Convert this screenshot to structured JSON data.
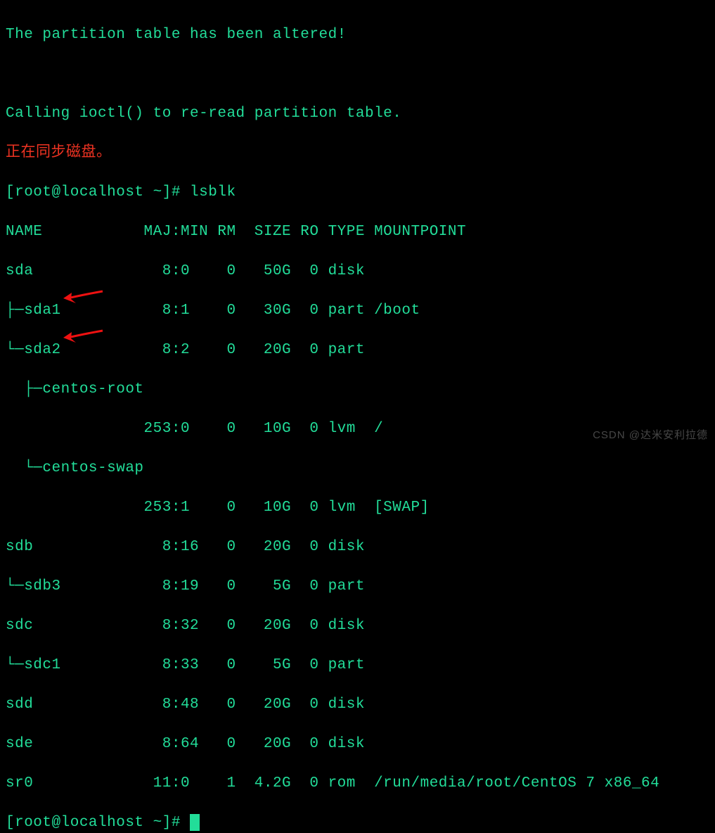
{
  "lines": {
    "msg1": "The partition table has been altered!",
    "blank": "",
    "msg2": "Calling ioctl() to re-read partition table.",
    "msg3": "正在同步磁盘。",
    "prompt1": "[root@localhost ~]# lsblk",
    "hdr": "NAME           MAJ:MIN RM  SIZE RO TYPE MOUNTPOINT",
    "sda": "sda              8:0    0   50G  0 disk ",
    "sda1": "├─sda1           8:1    0   30G  0 part /boot",
    "sda2": "└─sda2           8:2    0   20G  0 part ",
    "croot_lbl": "  ├─centos-root",
    "croot_val": "               253:0    0   10G  0 lvm  /",
    "cswap_lbl": "  └─centos-swap",
    "cswap_val": "               253:1    0   10G  0 lvm  [SWAP]",
    "sdb": "sdb              8:16   0   20G  0 disk ",
    "sdb3": "└─sdb3           8:19   0    5G  0 part ",
    "sdc": "sdc              8:32   0   20G  0 disk ",
    "sdc1": "└─sdc1           8:33   0    5G  0 part ",
    "sdd": "sdd              8:48   0   20G  0 disk ",
    "sde": "sde              8:64   0   20G  0 disk ",
    "sr0": "sr0             11:0    1  4.2G  0 rom  /run/media/root/CentOS 7 x86_64",
    "prompt2": "[root@localhost ~]# "
  },
  "watermark": "CSDN @达米安利拉德",
  "chart_data": {
    "type": "table",
    "title": "lsblk output",
    "columns": [
      "NAME",
      "MAJ:MIN",
      "RM",
      "SIZE",
      "RO",
      "TYPE",
      "MOUNTPOINT"
    ],
    "rows": [
      {
        "NAME": "sda",
        "MAJ:MIN": "8:0",
        "RM": 0,
        "SIZE": "50G",
        "RO": 0,
        "TYPE": "disk",
        "MOUNTPOINT": ""
      },
      {
        "NAME": "sda1",
        "MAJ:MIN": "8:1",
        "RM": 0,
        "SIZE": "30G",
        "RO": 0,
        "TYPE": "part",
        "MOUNTPOINT": "/boot"
      },
      {
        "NAME": "sda2",
        "MAJ:MIN": "8:2",
        "RM": 0,
        "SIZE": "20G",
        "RO": 0,
        "TYPE": "part",
        "MOUNTPOINT": ""
      },
      {
        "NAME": "centos-root",
        "MAJ:MIN": "253:0",
        "RM": 0,
        "SIZE": "10G",
        "RO": 0,
        "TYPE": "lvm",
        "MOUNTPOINT": "/"
      },
      {
        "NAME": "centos-swap",
        "MAJ:MIN": "253:1",
        "RM": 0,
        "SIZE": "10G",
        "RO": 0,
        "TYPE": "lvm",
        "MOUNTPOINT": "[SWAP]"
      },
      {
        "NAME": "sdb",
        "MAJ:MIN": "8:16",
        "RM": 0,
        "SIZE": "20G",
        "RO": 0,
        "TYPE": "disk",
        "MOUNTPOINT": ""
      },
      {
        "NAME": "sdb3",
        "MAJ:MIN": "8:19",
        "RM": 0,
        "SIZE": "5G",
        "RO": 0,
        "TYPE": "part",
        "MOUNTPOINT": ""
      },
      {
        "NAME": "sdc",
        "MAJ:MIN": "8:32",
        "RM": 0,
        "SIZE": "20G",
        "RO": 0,
        "TYPE": "disk",
        "MOUNTPOINT": ""
      },
      {
        "NAME": "sdc1",
        "MAJ:MIN": "8:33",
        "RM": 0,
        "SIZE": "5G",
        "RO": 0,
        "TYPE": "part",
        "MOUNTPOINT": ""
      },
      {
        "NAME": "sdd",
        "MAJ:MIN": "8:48",
        "RM": 0,
        "SIZE": "20G",
        "RO": 0,
        "TYPE": "disk",
        "MOUNTPOINT": ""
      },
      {
        "NAME": "sde",
        "MAJ:MIN": "8:64",
        "RM": 0,
        "SIZE": "20G",
        "RO": 0,
        "TYPE": "disk",
        "MOUNTPOINT": ""
      },
      {
        "NAME": "sr0",
        "MAJ:MIN": "11:0",
        "RM": 1,
        "SIZE": "4.2G",
        "RO": 0,
        "TYPE": "rom",
        "MOUNTPOINT": "/run/media/root/CentOS 7 x86_64"
      }
    ]
  }
}
